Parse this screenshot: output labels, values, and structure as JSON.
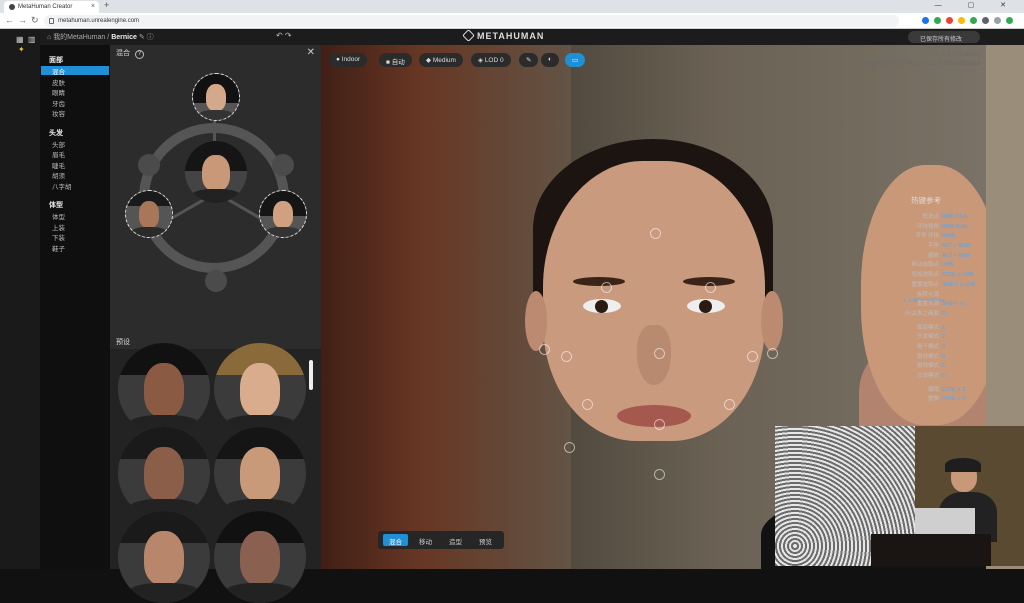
{
  "browser": {
    "tab_title": "MetaHuman Creator",
    "close_glyph": "×",
    "new_tab_glyph": "+",
    "url": "metahuman.unrealengine.com",
    "window_buttons": "— ▢ ✕",
    "extension_colors": [
      "#1a73e8",
      "#34a853",
      "#ea4335",
      "#fbbc04",
      "#34a853",
      "#5f6368",
      "#9aa0a6",
      "#34a853"
    ]
  },
  "topbar": {
    "breadcrumb_root": "我的MetaHuman",
    "breadcrumb_sep": "/",
    "character_name": "Bernice",
    "logo": "METAHUMAN",
    "save_label": "已保存所有修改"
  },
  "nav": {
    "groups": [
      {
        "label": "面部",
        "items": [
          "混合",
          "皮肤",
          "眼睛",
          "牙齿",
          "妆容"
        ],
        "selected": 0
      },
      {
        "label": "头发",
        "items": [
          "头部",
          "眉毛",
          "睫毛",
          "胡须",
          "八字胡"
        ]
      },
      {
        "label": "体型",
        "items": [
          "体型",
          "上装",
          "下装",
          "鞋子"
        ]
      }
    ]
  },
  "blend_panel": {
    "title": "混合",
    "help_glyph": "?",
    "close_glyph": "✕",
    "presets_title": "预设"
  },
  "viewport": {
    "toolbar": [
      "Indoor",
      "自动",
      "Medium",
      "LOD 0"
    ],
    "version_lines": [
      "0.5.2 (10.0000)",
      "e9f6d9b8-b8e3-4f2b-9e3a-9d83a0f6b3ed"
    ],
    "hotkeys_title": "热键参考",
    "hotkeys": [
      [
        "框选点",
        "RMB Click"
      ],
      [
        "环绕视角",
        "RMB Hold"
      ],
      [
        "平移 环绕",
        "MMB"
      ],
      [
        "平移",
        "ALT + MMB"
      ],
      [
        "缩放",
        "ALT + RMB"
      ],
      [
        "移动选取点",
        "LMB"
      ],
      [
        "增加选取点",
        "CTRL + LMB"
      ],
      [
        "重置选取点",
        "SHIFT + LMB"
      ],
      [
        "旋转光源",
        "L + Mouse Move"
      ],
      [
        "重置光源",
        "SHIFT + L"
      ],
      [
        "开/关表之画面",
        "O"
      ],
      [
        "面部模式",
        "1"
      ],
      [
        "头发模式",
        "2"
      ],
      [
        "躯干模式",
        "3"
      ],
      [
        "服饰模式",
        "4"
      ],
      [
        "服饰模式",
        "5"
      ],
      [
        "过滤模式",
        "6"
      ],
      [
        "撤销",
        "CTRL + Z"
      ],
      [
        "重做",
        "CTRL + Y"
      ]
    ],
    "bottom_tabs": [
      "混合",
      "移动",
      "造型",
      "预览"
    ],
    "bottom_selected": 0
  }
}
